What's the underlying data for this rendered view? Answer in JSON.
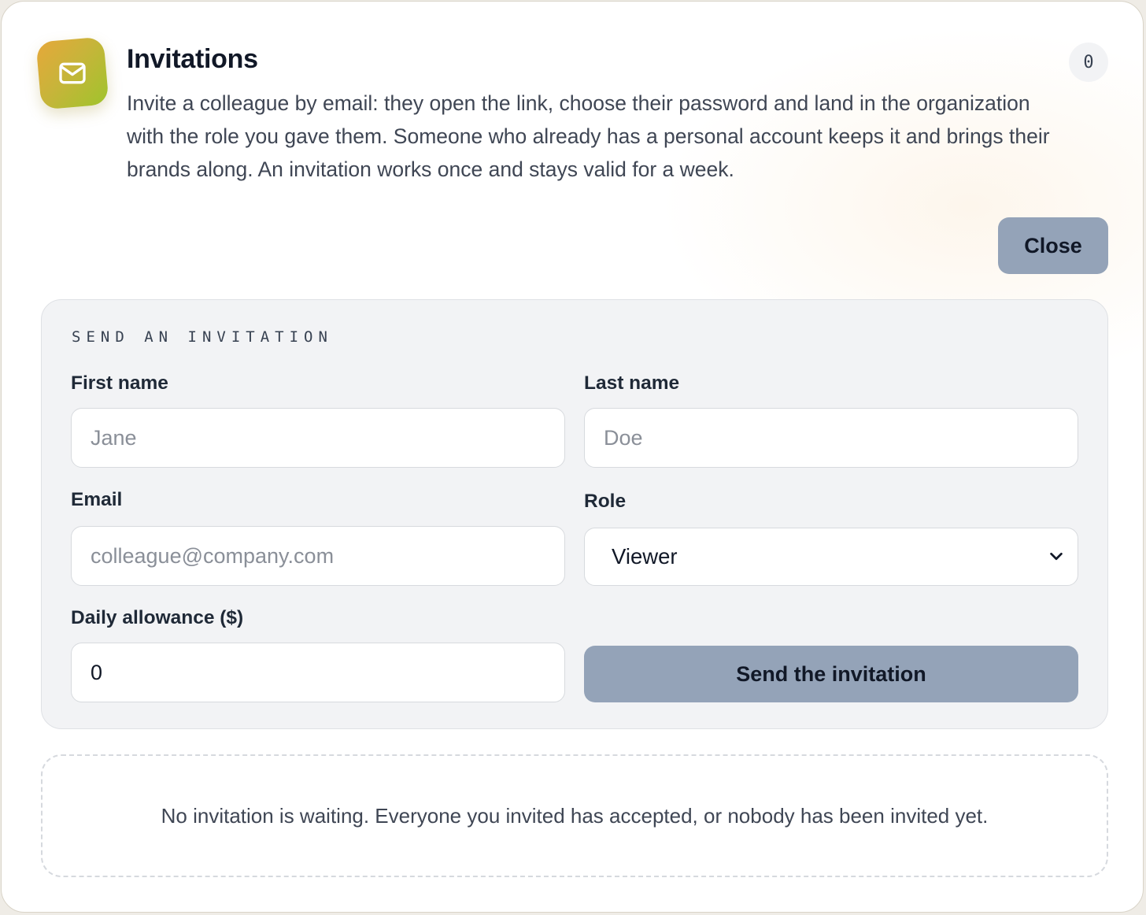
{
  "header": {
    "icon": "mail-icon",
    "title": "Invitations",
    "description": "Invite a colleague by email: they open the link, choose their password and land in the organization with the role you gave them. Someone who already has a personal account keeps it and brings their brands along. An invitation works once and stays valid for a week.",
    "pending_count": "0",
    "close_label": "Close"
  },
  "form": {
    "section_title": "SEND AN INVITATION",
    "first_name": {
      "label": "First name",
      "placeholder": "Jane",
      "value": ""
    },
    "last_name": {
      "label": "Last name",
      "placeholder": "Doe",
      "value": ""
    },
    "email": {
      "label": "Email",
      "placeholder": "colleague@company.com",
      "value": ""
    },
    "role": {
      "label": "Role",
      "selected": "Viewer"
    },
    "allowance": {
      "label": "Daily allowance ($)",
      "value": "0"
    },
    "submit_label": "Send the invitation"
  },
  "empty_state": {
    "text": "No invitation is waiting. Everyone you invited has accepted, or nobody has been invited yet."
  },
  "colors": {
    "accent_button": "#94a3b8",
    "icon_gradient_start": "#e6a83a",
    "icon_gradient_end": "#9fc42c",
    "panel_background": "#f2f3f5"
  }
}
